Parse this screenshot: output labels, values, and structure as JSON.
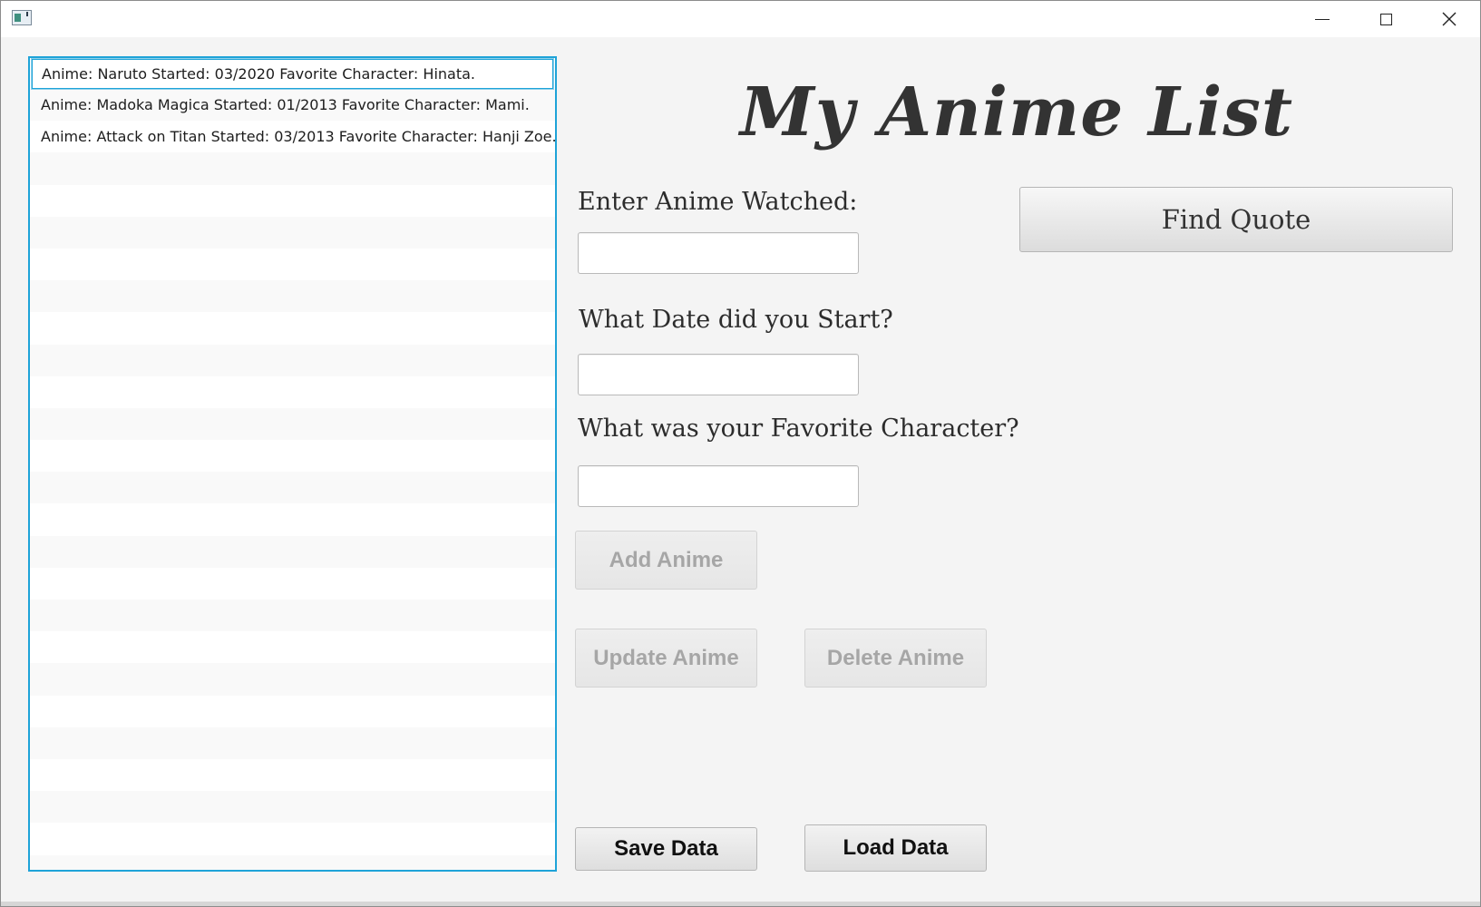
{
  "window": {
    "title": "",
    "controls": {
      "minimize": "minimize",
      "maximize": "maximize",
      "close": "close"
    }
  },
  "list": {
    "items": [
      "Anime: Naruto Started: 03/2020 Favorite Character: Hinata.",
      "Anime: Madoka Magica Started: 01/2013 Favorite Character: Mami.",
      "Anime: Attack on Titan Started: 03/2013 Favorite Character: Hanji Zoe."
    ],
    "selected_index": 0
  },
  "app": {
    "title": "My Anime List"
  },
  "form": {
    "anime_label": "Enter Anime Watched:",
    "anime_value": "",
    "date_label": "What Date did you Start?",
    "date_value": "",
    "character_label": "What was your Favorite Character?",
    "character_value": ""
  },
  "buttons": {
    "find_quote": "Find Quote",
    "add": "Add Anime",
    "update": "Update Anime",
    "delete": "Delete Anime",
    "save": "Save Data",
    "load": "Load Data"
  },
  "colors": {
    "accent": "#1ea3d8",
    "window_bg": "#f4f4f4",
    "title_text": "#333333",
    "disabled_text": "#a6a6a6"
  }
}
